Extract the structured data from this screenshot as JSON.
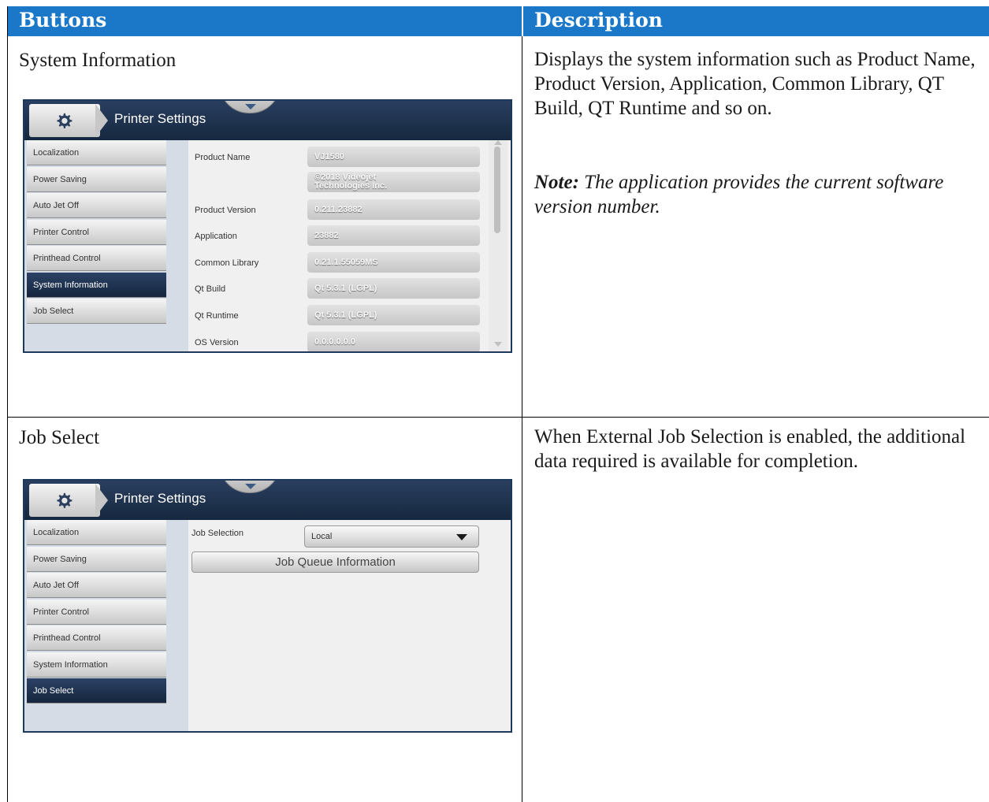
{
  "table": {
    "header": {
      "col1": "Buttons",
      "col2": "Description"
    },
    "rows": [
      {
        "title": "System Information",
        "description": "Displays the system information such as Product Name, Product Version, Application, Common Library, QT Build, QT Runtime and so on.",
        "note_label": "Note:",
        "note_text": " The application provides the current software version number.",
        "screen": {
          "header_title": "Printer Settings",
          "icon": "gear-icon",
          "nav": [
            "Localization",
            "Power Saving",
            "Auto Jet Off",
            "Printer Control",
            "Printhead Control",
            "System Information",
            "Job Select"
          ],
          "active_nav": "System Information",
          "fields": [
            {
              "label": "Product Name",
              "value": "VJ1580"
            },
            {
              "label": "",
              "value_line1": "©2018 Videojet",
              "value_line2": "Technologies Inc."
            },
            {
              "label": "Product Version",
              "value": "0.211.23882"
            },
            {
              "label": "Application",
              "value": "23882"
            },
            {
              "label": "Common Library",
              "value": "0.21.1.55059MS"
            },
            {
              "label": "Qt Build",
              "value": "Qt 5.3.1 (LGPL)"
            },
            {
              "label": "Qt Runtime",
              "value": "Qt 5.3.1 (LGPL)"
            },
            {
              "label": "OS Version",
              "value": "0.0.0.0.0.0"
            }
          ]
        }
      },
      {
        "title": "Job Select",
        "description": "When External Job Selection is enabled, the additional data required is available for completion.",
        "screen": {
          "header_title": "Printer Settings",
          "icon": "gear-icon",
          "nav": [
            "Localization",
            "Power Saving",
            "Auto Jet Off",
            "Printer Control",
            "Printhead Control",
            "System Information",
            "Job Select"
          ],
          "active_nav": "Job Select",
          "job_selection_label": "Job Selection",
          "job_selection_value": "Local",
          "job_queue_button": "Job Queue Information"
        }
      }
    ]
  },
  "colors": {
    "header_blue": "#1b78c8",
    "screen_navy": "#1d3a5c"
  }
}
